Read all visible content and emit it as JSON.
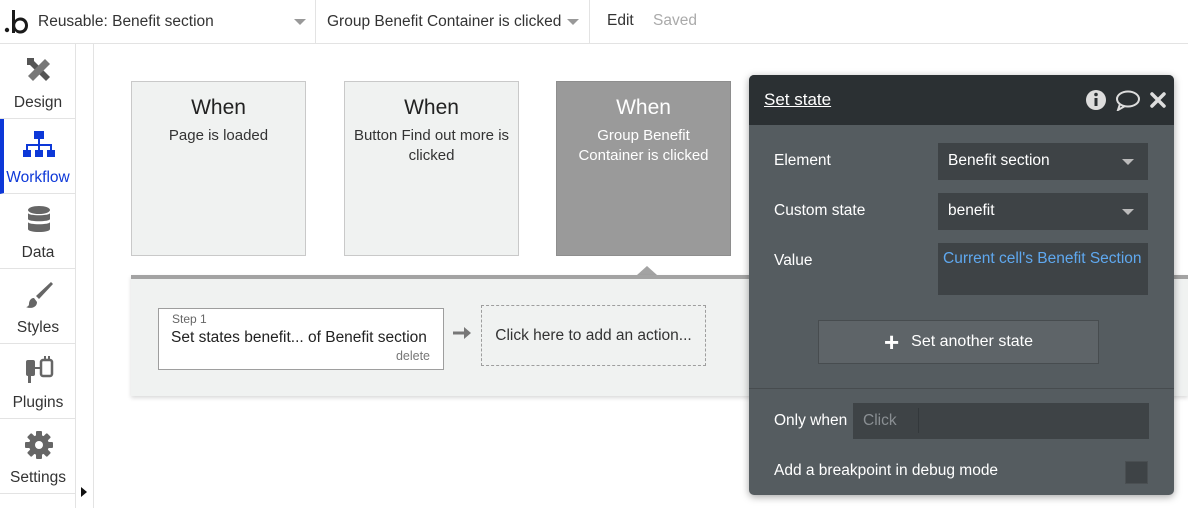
{
  "topbar": {
    "page_select": "Reusable: Benefit section",
    "event_select": "Group Benefit Container is clicked",
    "edit_label": "Edit",
    "saved_label": "Saved"
  },
  "sidebar": {
    "items": [
      {
        "label": "Design",
        "icon": "design-icon"
      },
      {
        "label": "Workflow",
        "icon": "workflow-icon",
        "active": true
      },
      {
        "label": "Data",
        "icon": "database-icon"
      },
      {
        "label": "Styles",
        "icon": "brush-icon"
      },
      {
        "label": "Plugins",
        "icon": "plug-icon"
      },
      {
        "label": "Settings",
        "icon": "gear-icon"
      }
    ]
  },
  "events": [
    {
      "when": "When",
      "desc": "Page is loaded"
    },
    {
      "when": "When",
      "desc": "Button Find out more is clicked"
    },
    {
      "when": "When",
      "desc": "Group Benefit Container is clicked",
      "selected": true
    }
  ],
  "actions": {
    "step_number": "Step 1",
    "step_title": "Set states benefit... of Benefit section",
    "delete_label": "delete",
    "add_action": "Click here to add an action..."
  },
  "panel": {
    "title": "Set state",
    "element_label": "Element",
    "element_value": "Benefit section",
    "custom_state_label": "Custom state",
    "custom_state_value": "benefit",
    "value_label": "Value",
    "value_expr": "Current cell's Benefit Section",
    "add_state_button": "Set another state",
    "only_when_label": "Only when",
    "only_when_placeholder": "Click",
    "breakpoint_label": "Add a breakpoint in debug mode"
  },
  "colors": {
    "accent": "#0d38d8",
    "panel_bg": "#555c60",
    "panel_header": "#2b3033",
    "expression_link": "#5fa8ef"
  }
}
